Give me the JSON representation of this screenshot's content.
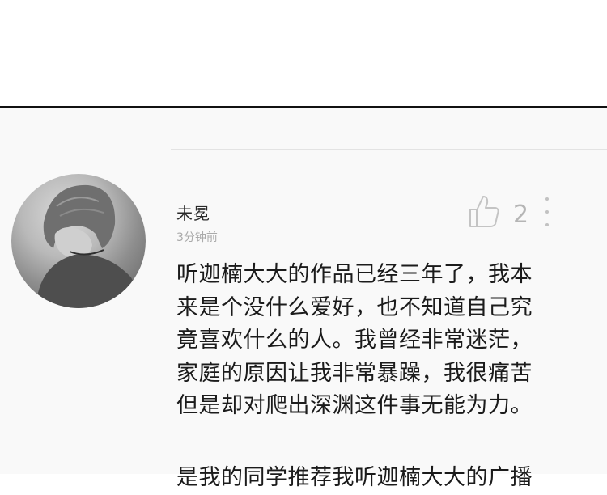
{
  "comment": {
    "username": "未冕",
    "timestamp": "3分钟前",
    "like_count": "2",
    "lines": [
      "听迦楠大大的作品已经三年了，我本",
      "来是个没什么爱好，也不知道自己究",
      "竟喜欢什么的人。我曾经非常迷茫，",
      "家庭的原因让我非常暴躁，我很痛苦",
      "但是却对爬出深渊这件事无能为力。"
    ],
    "partial_line": "是我的同学推荐我听迦楠大大的广播"
  },
  "icons": {
    "avatar": "avatar",
    "like": "thumbs-up-icon",
    "more": "vertical-dots-icon"
  },
  "colors": {
    "background": "#f9f9f9",
    "divider": "#111111",
    "separator": "#e3e3e3",
    "muted_text": "#aaaaaa"
  }
}
